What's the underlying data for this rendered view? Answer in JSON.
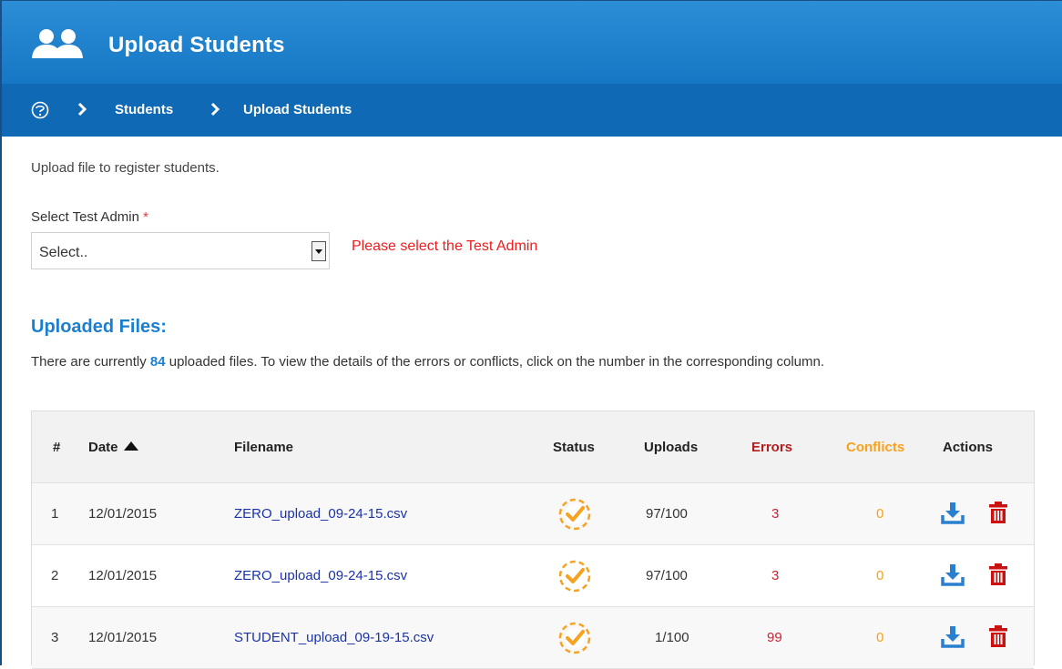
{
  "header": {
    "title": "Upload Students"
  },
  "breadcrumb": {
    "items": [
      "Students",
      "Upload Students"
    ]
  },
  "intro_text": "Upload file to register students.",
  "form": {
    "label": "Select Test Admin",
    "required_mark": "*",
    "select_value": "Select..",
    "error": "Please select the Test Admin"
  },
  "uploaded": {
    "title": "Uploaded Files:",
    "desc_prefix": "There are currently",
    "count": "84",
    "desc_suffix": "uploaded files. To view the details of the errors or conflicts, click on the number in the corresponding column."
  },
  "table": {
    "headers": {
      "num": "#",
      "date": "Date",
      "filename": "Filename",
      "status": "Status",
      "uploads": "Uploads",
      "errors": "Errors",
      "conflicts": "Conflicts",
      "actions": "Actions"
    },
    "rows": [
      {
        "num": "1",
        "date": "12/01/2015",
        "filename": "ZERO_upload_09-24-15.csv",
        "uploads": "97/100",
        "errors": "3",
        "conflicts": "0"
      },
      {
        "num": "2",
        "date": "12/01/2015",
        "filename": "ZERO_upload_09-24-15.csv",
        "uploads": "97/100",
        "errors": "3",
        "conflicts": "0"
      },
      {
        "num": "3",
        "date": "12/01/2015",
        "filename": "STUDENT_upload_09-19-15.csv",
        "uploads": "1/100",
        "errors": "99",
        "conflicts": "0"
      }
    ]
  },
  "colors": {
    "header_blue": "#1677c4",
    "breadcrumb_blue": "#0f69b4",
    "link_blue": "#1a33a8",
    "error_red": "#cc2233",
    "conflict_orange": "#f6a21f",
    "status_orange": "#f6a21f",
    "delete_red": "#cc1111"
  },
  "icons": {
    "title": "users-icon",
    "home": "info-circle-icon",
    "status": "check-badge-icon",
    "download": "download-icon",
    "delete": "trash-icon"
  }
}
